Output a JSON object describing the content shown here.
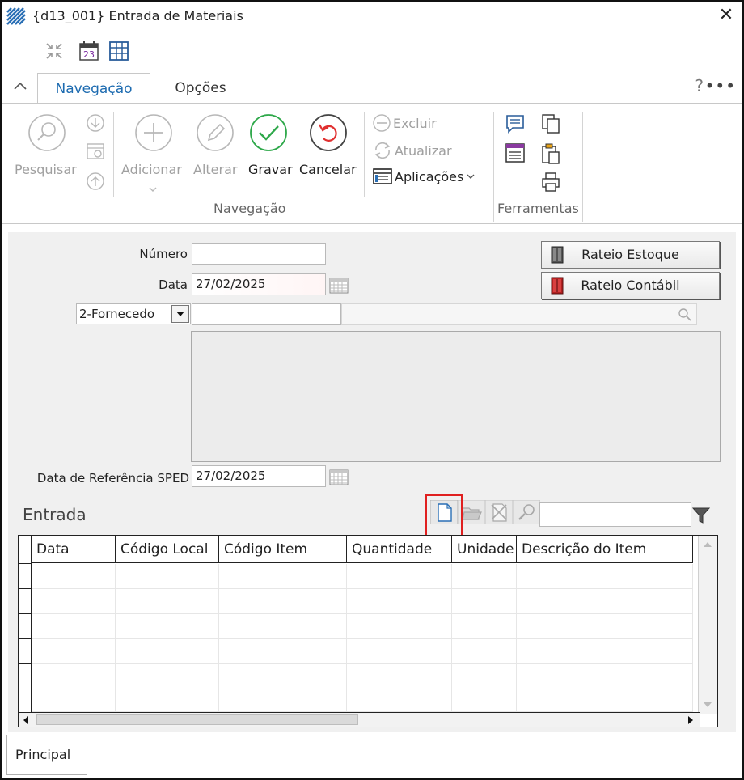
{
  "window": {
    "title": "{d13_001} Entrada de Materiais",
    "close_glyph": "✕"
  },
  "quick_access": {
    "icons": [
      "collapse-arrows-icon",
      "calendar-icon",
      "grid-settings-icon"
    ],
    "calendar_day": "23"
  },
  "tabs": [
    {
      "label": "Navegação",
      "active": true
    },
    {
      "label": "Opções",
      "active": false
    }
  ],
  "tab_extras": {
    "help": "?",
    "more": "•••"
  },
  "ribbon": {
    "pesquisar": "Pesquisar",
    "adicionar": "Adicionar",
    "alterar": "Alterar",
    "gravar": "Gravar",
    "cancelar": "Cancelar",
    "excluir": "Excluir",
    "atualizar": "Atualizar",
    "aplicacoes": "Aplicações",
    "group_navegacao": "Navegação",
    "group_ferramentas": "Ferramentas"
  },
  "form": {
    "numero_label": "Número",
    "numero_value": "",
    "data_label": "Data",
    "data_value": "27/02/2025",
    "fornecedor_select": "2-Fornecedo",
    "fornecedor_value": "",
    "data_ref_label": "Data de Referência SPED",
    "data_ref_value": "27/02/2025",
    "rateio_estoque": "Rateio Estoque",
    "rateio_contabil": "Rateio Contábil",
    "section_title": "Entrada"
  },
  "grid": {
    "columns": [
      "Data",
      "Código Local",
      "Código Item",
      "Quantidade",
      "Unidade",
      "Descrição do Item"
    ],
    "rows": []
  },
  "bottom_tabs": [
    "Principal"
  ],
  "colors": {
    "accent_blue": "#1d6bb0",
    "gravar_green": "#2ea84a",
    "cancelar_red": "#e03030",
    "highlight_red": "#e02020"
  }
}
